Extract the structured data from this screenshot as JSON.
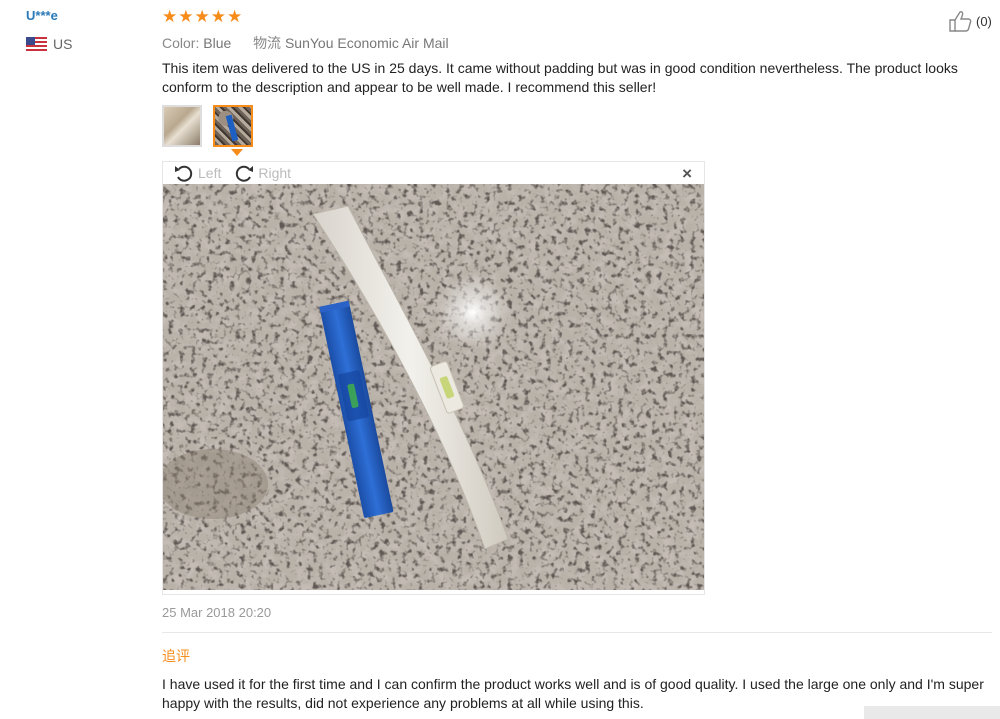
{
  "user": {
    "name": "U***e",
    "country": "US",
    "flag_icon": "us-flag-icon"
  },
  "rating": {
    "stars": 5,
    "max": 5,
    "color": "#f78c1b"
  },
  "helpful": {
    "icon": "thumbs-up-icon",
    "count": "(0)"
  },
  "meta": {
    "color_label": "Color:",
    "color_value": "Blue",
    "logistics_label": "物流",
    "logistics_value": "SunYou Economic Air Mail"
  },
  "review_text": "This item was delivered to the US in 25 days. It came without padding but was in good condition nevertheless. The product looks conform to the description and appear to be well made. I recommend this seller!",
  "gallery": {
    "thumbnails": [
      "review-photo-1",
      "review-photo-2"
    ],
    "active_index": 1,
    "rotate_left_label": "Left",
    "rotate_right_label": "Right",
    "close_icon": "close-icon"
  },
  "timestamp": "25 Mar 2018 20:20",
  "followup": {
    "label": "追评",
    "text": "I have used it for the first time and I can confirm the product works well and is of good quality. I used the large one only and I'm super happy with the results, did not experience any problems at all while using this."
  },
  "colors": {
    "accent": "#f78c1b",
    "username": "#2a7ab8"
  }
}
